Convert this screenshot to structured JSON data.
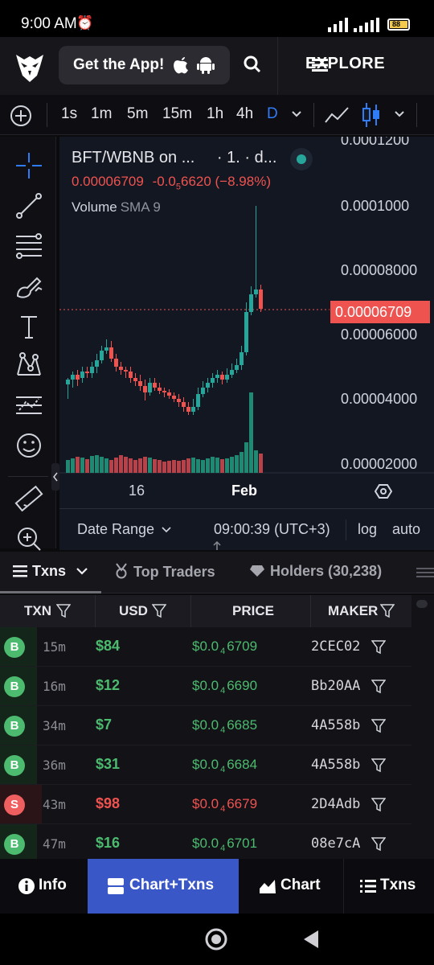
{
  "status_bar": {
    "time": "9:00 AM",
    "alarm_icon": "alarm-icon",
    "battery": "88"
  },
  "header": {
    "get_app_label": "Get the App!",
    "explore_label": "EXPLORE"
  },
  "toolbar": {
    "timeframes": [
      "1s",
      "1m",
      "5m",
      "15m",
      "1h",
      "4h",
      "D"
    ],
    "active_timeframe": "D"
  },
  "chart": {
    "pair_label": "BFT/WBNB on ...",
    "interval_label": "· 1. · d...",
    "last_price": "0.00006709",
    "change": "-0.0",
    "change_sub": "5",
    "change_rest": "6620 (−8.98%)",
    "volume_label": "Volume",
    "sma_label": "SMA 9",
    "y_axis_labels": [
      "0.0001200",
      "0.0001000",
      "0.00008000",
      "0.00006000",
      "0.00004000",
      "0.00002000"
    ],
    "price_tag": "0.00006709",
    "x_axis_labels": [
      "16",
      "Feb"
    ],
    "date_range_label": "Date Range",
    "clock": "09:00:39 (UTC+3)",
    "log_label": "log",
    "auto_label": "auto",
    "colors": {
      "up": "#26a69a",
      "down": "#ef5350",
      "volume_up": "#1f8a73",
      "volume_down": "#b8424a"
    }
  },
  "tabs": {
    "txns": "Txns",
    "top_traders": "Top Traders",
    "holders": "Holders (30,238)"
  },
  "table": {
    "headers": {
      "txn": "TXN",
      "usd": "USD",
      "price": "PRICE",
      "maker": "MAKER"
    },
    "rows": [
      {
        "type": "B",
        "age": "15m",
        "usd": "$84",
        "price_a": "$0.0",
        "price_sub": "4",
        "price_b": "6709",
        "maker": "2CEC02"
      },
      {
        "type": "B",
        "age": "16m",
        "usd": "$12",
        "price_a": "$0.0",
        "price_sub": "4",
        "price_b": "6690",
        "maker": "Bb20AA"
      },
      {
        "type": "B",
        "age": "34m",
        "usd": "$7",
        "price_a": "$0.0",
        "price_sub": "4",
        "price_b": "6685",
        "maker": "4A558b"
      },
      {
        "type": "B",
        "age": "36m",
        "usd": "$31",
        "price_a": "$0.0",
        "price_sub": "4",
        "price_b": "6684",
        "maker": "4A558b"
      },
      {
        "type": "S",
        "age": "43m",
        "usd": "$98",
        "price_a": "$0.0",
        "price_sub": "4",
        "price_b": "6679",
        "maker": "2D4Adb"
      },
      {
        "type": "B",
        "age": "47m",
        "usd": "$16",
        "price_a": "$0.0",
        "price_sub": "4",
        "price_b": "6701",
        "maker": "08e7cA"
      }
    ]
  },
  "bottom_nav": {
    "info": "Info",
    "chart_txns": "Chart+Txns",
    "chart": "Chart",
    "txns": "Txns"
  }
}
